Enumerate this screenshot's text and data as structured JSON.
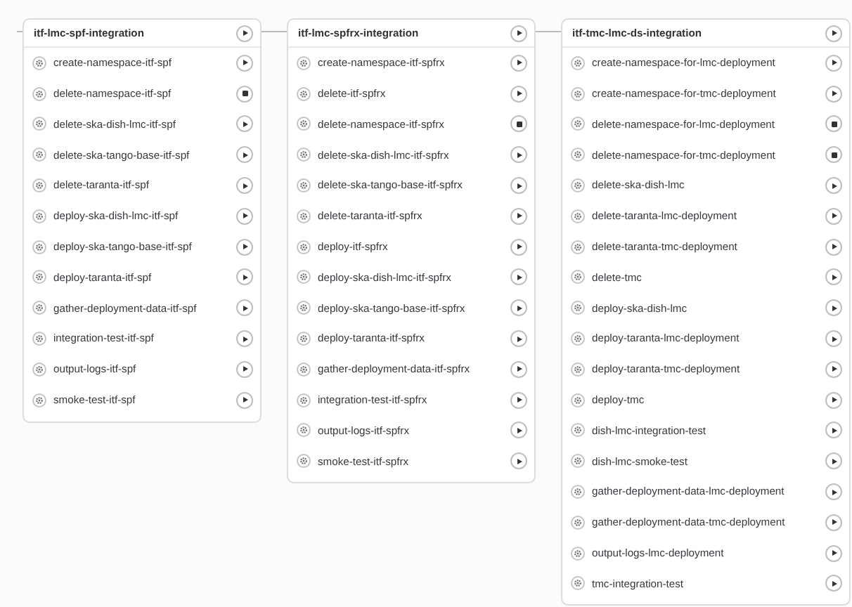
{
  "stages": [
    {
      "title": "itf-lmc-spf-integration",
      "kind": "play",
      "jobs": [
        {
          "name": "create-namespace-itf-spf",
          "kind": "play"
        },
        {
          "name": "delete-namespace-itf-spf",
          "kind": "stop"
        },
        {
          "name": "delete-ska-dish-lmc-itf-spf",
          "kind": "play"
        },
        {
          "name": "delete-ska-tango-base-itf-spf",
          "kind": "play"
        },
        {
          "name": "delete-taranta-itf-spf",
          "kind": "play"
        },
        {
          "name": "deploy-ska-dish-lmc-itf-spf",
          "kind": "play"
        },
        {
          "name": "deploy-ska-tango-base-itf-spf",
          "kind": "play"
        },
        {
          "name": "deploy-taranta-itf-spf",
          "kind": "play"
        },
        {
          "name": "gather-deployment-data-itf-spf",
          "kind": "play"
        },
        {
          "name": "integration-test-itf-spf",
          "kind": "play"
        },
        {
          "name": "output-logs-itf-spf",
          "kind": "play"
        },
        {
          "name": "smoke-test-itf-spf",
          "kind": "play"
        }
      ]
    },
    {
      "title": "itf-lmc-spfrx-integration",
      "kind": "play",
      "jobs": [
        {
          "name": "create-namespace-itf-spfrx",
          "kind": "play"
        },
        {
          "name": "delete-itf-spfrx",
          "kind": "play"
        },
        {
          "name": "delete-namespace-itf-spfrx",
          "kind": "stop"
        },
        {
          "name": "delete-ska-dish-lmc-itf-spfrx",
          "kind": "play"
        },
        {
          "name": "delete-ska-tango-base-itf-spfrx",
          "kind": "play"
        },
        {
          "name": "delete-taranta-itf-spfrx",
          "kind": "play"
        },
        {
          "name": "deploy-itf-spfrx",
          "kind": "play"
        },
        {
          "name": "deploy-ska-dish-lmc-itf-spfrx",
          "kind": "play"
        },
        {
          "name": "deploy-ska-tango-base-itf-spfrx",
          "kind": "play"
        },
        {
          "name": "deploy-taranta-itf-spfrx",
          "kind": "play"
        },
        {
          "name": "gather-deployment-data-itf-spfrx",
          "kind": "play"
        },
        {
          "name": "integration-test-itf-spfrx",
          "kind": "play"
        },
        {
          "name": "output-logs-itf-spfrx",
          "kind": "play"
        },
        {
          "name": "smoke-test-itf-spfrx",
          "kind": "play"
        }
      ]
    },
    {
      "title": "itf-tmc-lmc-ds-integration",
      "kind": "play",
      "jobs": [
        {
          "name": "create-namespace-for-lmc-deployment",
          "kind": "play"
        },
        {
          "name": "create-namespace-for-tmc-deployment",
          "kind": "play"
        },
        {
          "name": "delete-namespace-for-lmc-deployment",
          "kind": "stop"
        },
        {
          "name": "delete-namespace-for-tmc-deployment",
          "kind": "stop"
        },
        {
          "name": "delete-ska-dish-lmc",
          "kind": "play"
        },
        {
          "name": "delete-taranta-lmc-deployment",
          "kind": "play"
        },
        {
          "name": "delete-taranta-tmc-deployment",
          "kind": "play"
        },
        {
          "name": "delete-tmc",
          "kind": "play"
        },
        {
          "name": "deploy-ska-dish-lmc",
          "kind": "play"
        },
        {
          "name": "deploy-taranta-lmc-deployment",
          "kind": "play"
        },
        {
          "name": "deploy-taranta-tmc-deployment",
          "kind": "play"
        },
        {
          "name": "deploy-tmc",
          "kind": "play"
        },
        {
          "name": "dish-lmc-integration-test",
          "kind": "play"
        },
        {
          "name": "dish-lmc-smoke-test",
          "kind": "play"
        },
        {
          "name": "gather-deployment-data-lmc-deployment",
          "kind": "play"
        },
        {
          "name": "gather-deployment-data-tmc-deployment",
          "kind": "play"
        },
        {
          "name": "output-logs-lmc-deployment",
          "kind": "play"
        },
        {
          "name": "tmc-integration-test",
          "kind": "play"
        }
      ]
    }
  ]
}
